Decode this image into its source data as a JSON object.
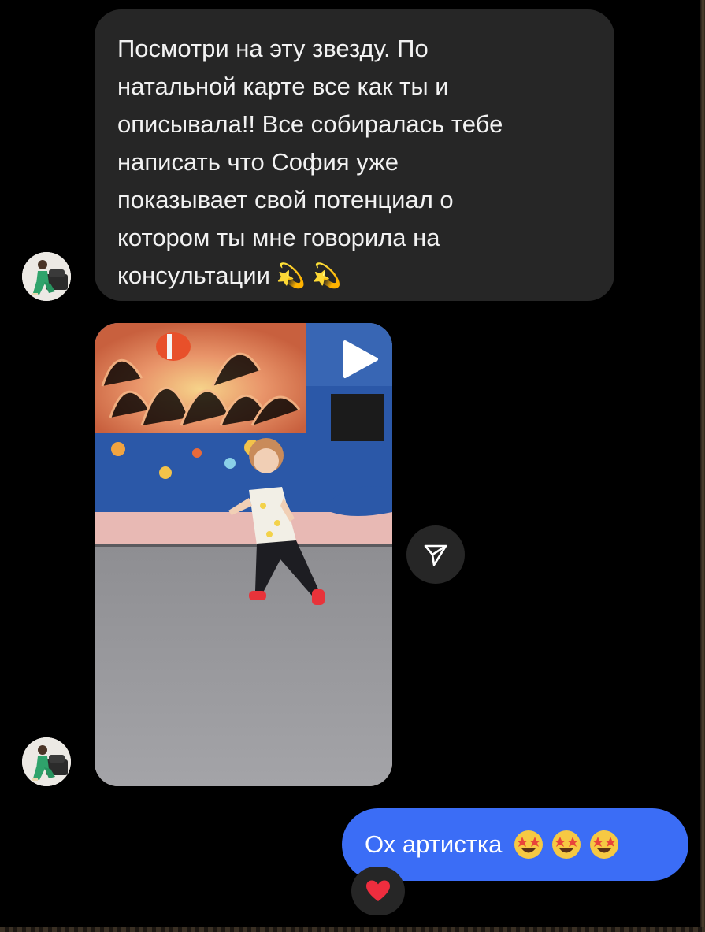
{
  "conversation": {
    "incoming_message": {
      "lines": [
        "Посмотри на эту звезду. По",
        "натальной карте все как ты и",
        "описывала!! Все собиралась тебе",
        "написать что София уже",
        "показывает свой потенциал о",
        "котором ты мне говорила на",
        "консультации"
      ],
      "emojis": [
        "💫",
        "💫"
      ]
    },
    "video_message": {
      "play_icon": "play-icon",
      "share_icon": "send-icon"
    },
    "outgoing_message": {
      "text": "Ох артистка",
      "emojis": [
        "🤩",
        "🤩",
        "🤩"
      ]
    },
    "reaction": {
      "emoji": "❤️"
    }
  },
  "colors": {
    "background": "#000000",
    "incoming_bubble": "#262626",
    "outgoing_bubble": "#3b6df6",
    "text": "#f2f2f2"
  }
}
